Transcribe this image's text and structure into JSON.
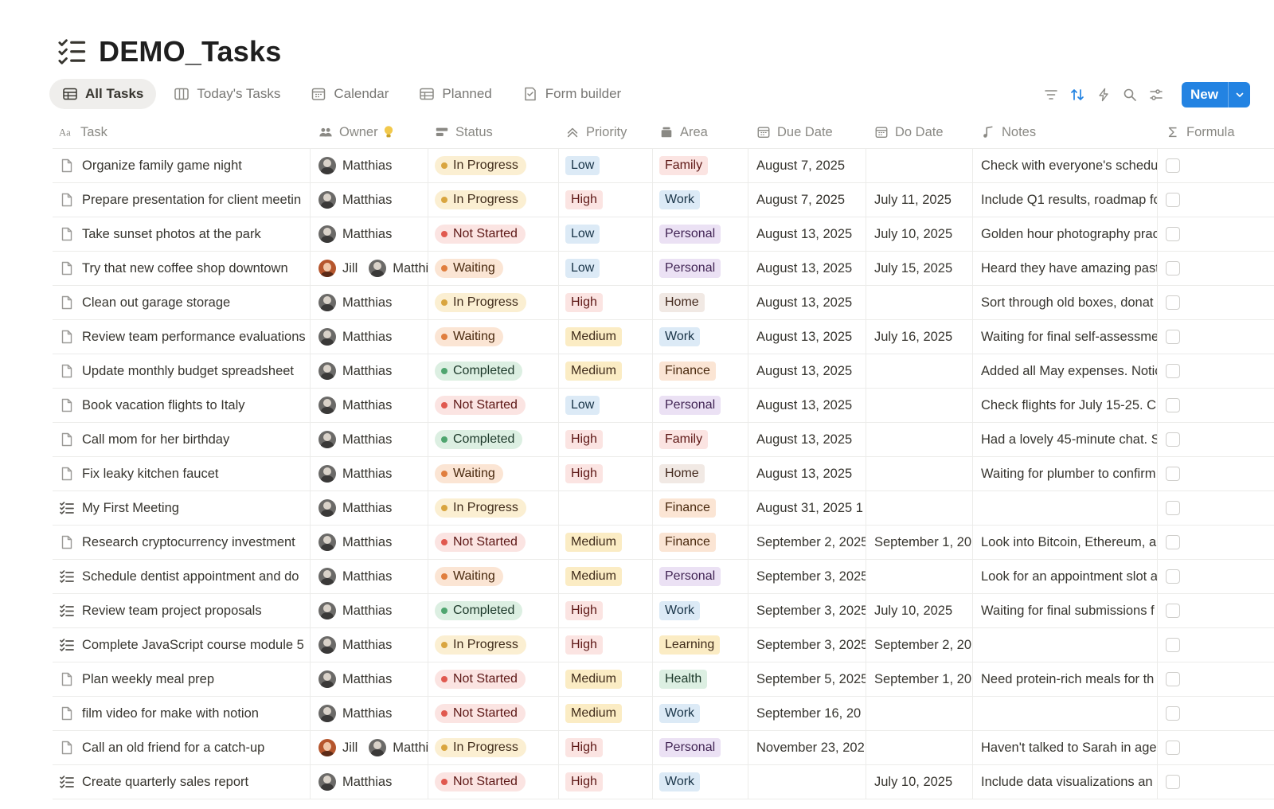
{
  "page": {
    "title": "DEMO_Tasks",
    "icon": "checklist-icon"
  },
  "views": [
    {
      "label": "All Tasks",
      "icon": "table-icon",
      "active": true
    },
    {
      "label": "Today's Tasks",
      "icon": "board-icon",
      "active": false
    },
    {
      "label": "Calendar",
      "icon": "calendar-icon",
      "active": false
    },
    {
      "label": "Planned",
      "icon": "table-icon",
      "active": false
    },
    {
      "label": "Form builder",
      "icon": "form-icon",
      "active": false
    }
  ],
  "toolbar": {
    "icons": [
      "filter-icon",
      "sort-icon",
      "automation-icon",
      "search-icon",
      "settings-icon"
    ],
    "new_label": "New",
    "accent": "#2383e2"
  },
  "columns": [
    {
      "key": "task",
      "label": "Task",
      "icon": "text-icon"
    },
    {
      "key": "owner",
      "label": "Owner",
      "icon": "people-icon"
    },
    {
      "key": "status",
      "label": "Status",
      "icon": "status-icon"
    },
    {
      "key": "priority",
      "label": "Priority",
      "icon": "priority-icon"
    },
    {
      "key": "area",
      "label": "Area",
      "icon": "area-icon"
    },
    {
      "key": "due",
      "label": "Due Date",
      "icon": "calendar-icon"
    },
    {
      "key": "do",
      "label": "Do Date",
      "icon": "calendar-icon"
    },
    {
      "key": "notes",
      "label": "Notes",
      "icon": "notes-icon"
    },
    {
      "key": "formula",
      "label": "Formula",
      "icon": "sigma-icon"
    }
  ],
  "colors": {
    "status": {
      "In Progress": {
        "bg": "#fbefd2",
        "fg": "#402c1b",
        "dot": "#d9a53f"
      },
      "Not Started": {
        "bg": "#fbe4e2",
        "fg": "#5d1715",
        "dot": "#e0594f"
      },
      "Waiting": {
        "bg": "#fbe5d4",
        "fg": "#49290e",
        "dot": "#e07e3e"
      },
      "Completed": {
        "bg": "#dcefe2",
        "fg": "#1c3829",
        "dot": "#4fa56f"
      }
    },
    "priority": {
      "Low": {
        "bg": "#dceaf6",
        "fg": "#183347"
      },
      "High": {
        "bg": "#fbe4e2",
        "fg": "#5d1715"
      },
      "Medium": {
        "bg": "#fbecc4",
        "fg": "#402c1b"
      }
    },
    "area": {
      "Family": {
        "bg": "#fbe4e2",
        "fg": "#5d1715"
      },
      "Work": {
        "bg": "#dceaf6",
        "fg": "#183347"
      },
      "Personal": {
        "bg": "#ebe1f4",
        "fg": "#412454"
      },
      "Home": {
        "bg": "#f1e9e4",
        "fg": "#442a1e"
      },
      "Finance": {
        "bg": "#fbe5d4",
        "fg": "#49290e"
      },
      "Learning": {
        "bg": "#fbecc4",
        "fg": "#402c1b"
      },
      "Health": {
        "bg": "#dcefe2",
        "fg": "#1c3829"
      }
    }
  },
  "rows": [
    {
      "icon": "page-icon",
      "task": "Organize family game night",
      "owners": [
        {
          "name": "Matthias",
          "avatar": "m"
        }
      ],
      "status": "In Progress",
      "priority": "Low",
      "area": "Family",
      "due": "August 7, 2025",
      "do": "",
      "notes": "Check with everyone's schedu"
    },
    {
      "icon": "page-icon",
      "task": "Prepare presentation for client meetin",
      "owners": [
        {
          "name": "Matthias",
          "avatar": "m"
        }
      ],
      "status": "In Progress",
      "priority": "High",
      "area": "Work",
      "due": "August 7, 2025",
      "do": "July 11, 2025",
      "notes": "Include Q1 results, roadmap fo"
    },
    {
      "icon": "page-icon",
      "task": "Take sunset photos at the park",
      "owners": [
        {
          "name": "Matthias",
          "avatar": "m"
        }
      ],
      "status": "Not Started",
      "priority": "Low",
      "area": "Personal",
      "due": "August 13, 2025",
      "do": "July 10, 2025",
      "notes": "Golden hour photography prac"
    },
    {
      "icon": "page-icon",
      "task": "Try that new coffee shop downtown",
      "owners": [
        {
          "name": "Jill",
          "avatar": "j"
        },
        {
          "name": "Matthi",
          "avatar": "m"
        }
      ],
      "status": "Waiting",
      "priority": "Low",
      "area": "Personal",
      "due": "August 13, 2025",
      "do": "July 15, 2025",
      "notes": "Heard they have amazing pastr"
    },
    {
      "icon": "page-icon",
      "task": "Clean out garage storage",
      "owners": [
        {
          "name": "Matthias",
          "avatar": "m"
        }
      ],
      "status": "In Progress",
      "priority": "High",
      "area": "Home",
      "due": "August 13, 2025",
      "do": "",
      "notes": "Sort through old boxes, donat"
    },
    {
      "icon": "page-icon",
      "task": "Review team performance evaluations",
      "owners": [
        {
          "name": "Matthias",
          "avatar": "m"
        }
      ],
      "status": "Waiting",
      "priority": "Medium",
      "area": "Work",
      "due": "August 13, 2025",
      "do": "July 16, 2025",
      "notes": "Waiting for final self-assessme"
    },
    {
      "icon": "page-icon",
      "task": "Update monthly budget spreadsheet",
      "owners": [
        {
          "name": "Matthias",
          "avatar": "m"
        }
      ],
      "status": "Completed",
      "priority": "Medium",
      "area": "Finance",
      "due": "August 13, 2025",
      "do": "",
      "notes": "Added all May expenses. Notic"
    },
    {
      "icon": "page-icon",
      "task": "Book vacation flights to Italy",
      "owners": [
        {
          "name": "Matthias",
          "avatar": "m"
        }
      ],
      "status": "Not Started",
      "priority": "Low",
      "area": "Personal",
      "due": "August 13, 2025",
      "do": "",
      "notes": "Check flights for July 15-25. C"
    },
    {
      "icon": "page-icon",
      "task": "Call mom for her birthday",
      "owners": [
        {
          "name": "Matthias",
          "avatar": "m"
        }
      ],
      "status": "Completed",
      "priority": "High",
      "area": "Family",
      "due": "August 13, 2025",
      "do": "",
      "notes": "Had a lovely 45-minute chat. S"
    },
    {
      "icon": "page-icon",
      "task": "Fix leaky kitchen faucet",
      "owners": [
        {
          "name": "Matthias",
          "avatar": "m"
        }
      ],
      "status": "Waiting",
      "priority": "High",
      "area": "Home",
      "due": "August 13, 2025",
      "do": "",
      "notes": "Waiting for plumber to confirm"
    },
    {
      "icon": "checklist-icon",
      "task": "My First Meeting",
      "owners": [
        {
          "name": "Matthias",
          "avatar": "m"
        }
      ],
      "status": "In Progress",
      "priority": "",
      "area": "Finance",
      "due": "August 31, 2025 1",
      "do": "",
      "notes": ""
    },
    {
      "icon": "page-icon",
      "task": "Research cryptocurrency investment",
      "owners": [
        {
          "name": "Matthias",
          "avatar": "m"
        }
      ],
      "status": "Not Started",
      "priority": "Medium",
      "area": "Finance",
      "due": "September 2, 2025",
      "do": "September 1, 20",
      "notes": "Look into Bitcoin, Ethereum, a"
    },
    {
      "icon": "checklist-icon",
      "task": "Schedule dentist appointment and do",
      "owners": [
        {
          "name": "Matthias",
          "avatar": "m"
        }
      ],
      "status": "Waiting",
      "priority": "Medium",
      "area": "Personal",
      "due": "September 3, 2025",
      "do": "",
      "notes": "Look for an appointment slot a"
    },
    {
      "icon": "checklist-icon",
      "task": "Review team project proposals",
      "owners": [
        {
          "name": "Matthias",
          "avatar": "m"
        }
      ],
      "status": "Completed",
      "priority": "High",
      "area": "Work",
      "due": "September 3, 2025",
      "do": "July 10, 2025",
      "notes": "Waiting for final submissions f"
    },
    {
      "icon": "checklist-icon",
      "task": "Complete JavaScript course module 5",
      "owners": [
        {
          "name": "Matthias",
          "avatar": "m"
        }
      ],
      "status": "In Progress",
      "priority": "High",
      "area": "Learning",
      "due": "September 3, 2025",
      "do": "September 2, 20",
      "notes": ""
    },
    {
      "icon": "page-icon",
      "task": "Plan weekly meal prep",
      "owners": [
        {
          "name": "Matthias",
          "avatar": "m"
        }
      ],
      "status": "Not Started",
      "priority": "Medium",
      "area": "Health",
      "due": "September 5, 2025",
      "do": "September 1, 20",
      "notes": "Need protein-rich meals for th"
    },
    {
      "icon": "page-icon",
      "task": "film video for make with notion",
      "owners": [
        {
          "name": "Matthias",
          "avatar": "m"
        }
      ],
      "status": "Not Started",
      "priority": "Medium",
      "area": "Work",
      "due": "September 16, 20",
      "do": "",
      "notes": ""
    },
    {
      "icon": "page-icon",
      "task": "Call an old friend for a catch-up",
      "owners": [
        {
          "name": "Jill",
          "avatar": "j"
        },
        {
          "name": "Matthi",
          "avatar": "m"
        }
      ],
      "status": "In Progress",
      "priority": "High",
      "area": "Personal",
      "due": "November 23, 202",
      "do": "",
      "notes": "Haven't talked to Sarah in age"
    },
    {
      "icon": "checklist-icon",
      "task": "Create quarterly sales report",
      "owners": [
        {
          "name": "Matthias",
          "avatar": "m"
        }
      ],
      "status": "Not Started",
      "priority": "High",
      "area": "Work",
      "due": "",
      "do": "July 10, 2025",
      "notes": "Include data visualizations an"
    }
  ]
}
